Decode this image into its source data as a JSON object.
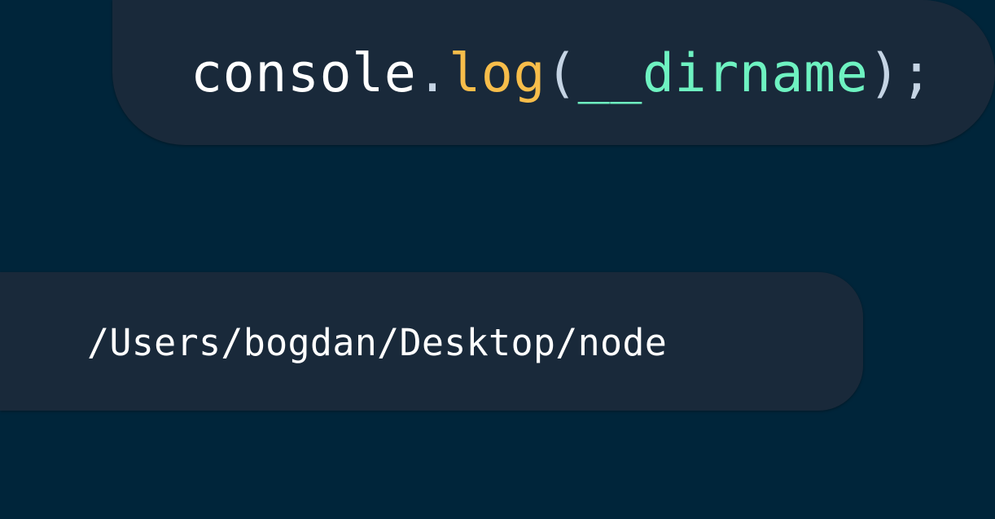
{
  "code": {
    "tokens": [
      {
        "text": "console",
        "color": "#ffffff"
      },
      {
        "text": ".",
        "color": "#c5d4e4"
      },
      {
        "text": "log",
        "color": "#f7bd4a"
      },
      {
        "text": "(",
        "color": "#c5d4e4"
      },
      {
        "text": "__dirname",
        "color": "#6ef2c1"
      },
      {
        "text": ")",
        "color": "#c5d4e4"
      },
      {
        "text": ";",
        "color": "#c5d4e4"
      }
    ]
  },
  "output": {
    "text": "/Users/bogdan/Desktop/node",
    "color": "#ffffff"
  },
  "colors": {
    "background": "#00253a",
    "bubble": "#19293a"
  }
}
